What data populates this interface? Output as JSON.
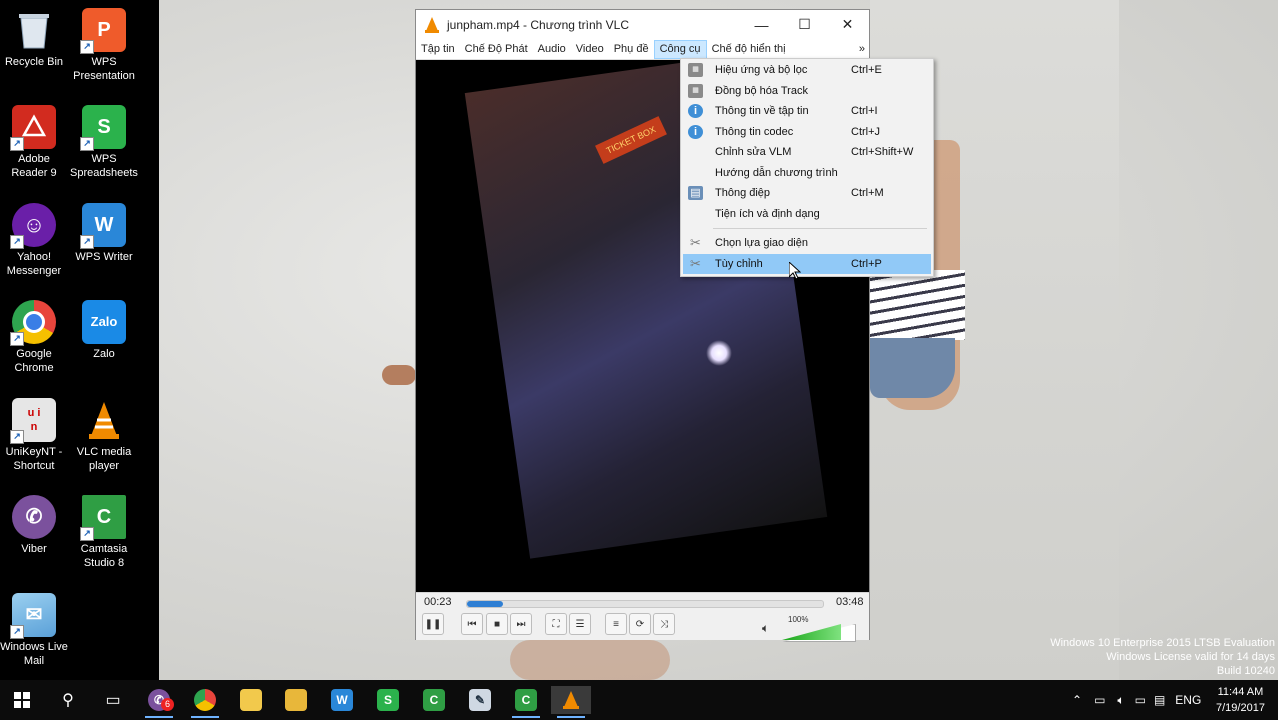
{
  "desktop": {
    "icons_col1": [
      {
        "label": "Recycle Bin",
        "icon": "recycle-bin-icon",
        "color": "#c8d4e0"
      },
      {
        "label": "Adobe Reader 9",
        "icon": "adobe-reader-icon",
        "color": "#d22b1f"
      },
      {
        "label": "Yahoo! Messenger",
        "icon": "yahoo-messenger-icon",
        "color": "#6a1fa8"
      },
      {
        "label": "Google Chrome",
        "icon": "chrome-icon",
        "color": "#e8453c"
      },
      {
        "label": "UniKeyNT - Shortcut",
        "icon": "unikey-icon",
        "color": "#dcdcdc"
      },
      {
        "label": "Viber",
        "icon": "viber-icon",
        "color": "#7b519d"
      },
      {
        "label": "Windows Live Mail",
        "icon": "live-mail-icon",
        "color": "#6fa8d8"
      }
    ],
    "icons_col2": [
      {
        "label": "WPS Presentation",
        "icon": "wps-presentation-icon",
        "color": "#ef5b2b",
        "glyph": "P"
      },
      {
        "label": "WPS Spreadsheets",
        "icon": "wps-spreadsheets-icon",
        "color": "#2bb24c",
        "glyph": "S"
      },
      {
        "label": "WPS Writer",
        "icon": "wps-writer-icon",
        "color": "#2a87d8",
        "glyph": "W"
      },
      {
        "label": "Zalo",
        "icon": "zalo-icon",
        "color": "#1a8ae6",
        "glyph": "Zalo"
      },
      {
        "label": "VLC media player",
        "icon": "vlc-icon",
        "color": "#f08a00",
        "glyph": "▲"
      },
      {
        "label": "Camtasia Studio 8",
        "icon": "camtasia-icon",
        "color": "#2f9e44",
        "glyph": "C"
      }
    ]
  },
  "vlc": {
    "title": "junpham.mp4 - Chương trình VLC",
    "menu": [
      "Tập tin",
      "Chế Độ Phát",
      "Audio",
      "Video",
      "Phụ đề",
      "Công cụ",
      "Chế độ hiển thị"
    ],
    "menu_more": "»",
    "active_menu_index": 5,
    "time_elapsed": "00:23",
    "time_total": "03:48",
    "progress_fraction": 0.1,
    "volume_label": "100%",
    "volume_fraction": 0.82,
    "video_sign": "TICKET BOX"
  },
  "tools_menu": {
    "items": [
      {
        "label": "Hiệu ứng và bộ lọc",
        "shortcut": "Ctrl+E",
        "icon": "film-icon"
      },
      {
        "label": "Đồng bộ hóa Track",
        "shortcut": "",
        "icon": "film-icon"
      },
      {
        "label": "Thông tin về tập tin",
        "shortcut": "Ctrl+I",
        "icon": "info-icon"
      },
      {
        "label": "Thông tin codec",
        "shortcut": "Ctrl+J",
        "icon": "info-icon"
      },
      {
        "label": "Chỉnh sửa VLM",
        "shortcut": "Ctrl+Shift+W",
        "icon": ""
      },
      {
        "label": "Hướng dẫn chương trình",
        "shortcut": "",
        "icon": ""
      },
      {
        "label": "Thông điệp",
        "shortcut": "Ctrl+M",
        "icon": "message-icon"
      },
      {
        "label": "Tiện ích và định dạng",
        "shortcut": "",
        "icon": ""
      },
      {
        "label": "Chọn lựa giao diện",
        "shortcut": "",
        "icon": "tools-icon"
      },
      {
        "label": "Tùy chỉnh",
        "shortcut": "Ctrl+P",
        "icon": "tools-icon",
        "highlighted": true
      }
    ]
  },
  "watermark": {
    "line1": "Windows 10 Enterprise 2015 LTSB Evaluation",
    "line2": "Windows License valid for 14 days",
    "line3": "Build 10240"
  },
  "taskbar": {
    "language": "ENG",
    "time": "11:44 AM",
    "date": "7/19/2017",
    "viber_badge": "6"
  }
}
